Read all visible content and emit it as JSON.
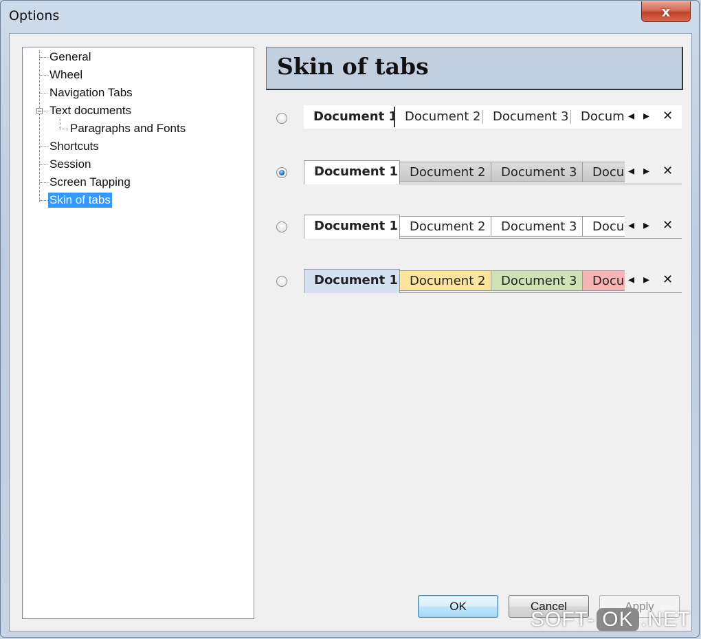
{
  "window": {
    "title": "Options",
    "close_glyph": "x"
  },
  "tree": {
    "items": [
      {
        "label": "General"
      },
      {
        "label": "Wheel"
      },
      {
        "label": "Navigation Tabs"
      },
      {
        "label": "Text documents"
      },
      {
        "label": "Paragraphs and Fonts"
      },
      {
        "label": "Shortcuts"
      },
      {
        "label": "Session"
      },
      {
        "label": "Screen Tapping"
      },
      {
        "label": "Skin of tabs",
        "selected": true
      }
    ]
  },
  "panel": {
    "title": "Skin of tabs"
  },
  "skins": [
    {
      "selected": false,
      "tabs": [
        "Document 1",
        "Document 2",
        "Document 3",
        "Docum"
      ]
    },
    {
      "selected": true,
      "tabs": [
        "Document 1",
        "Document 2",
        "Document 3",
        "Docu"
      ]
    },
    {
      "selected": false,
      "tabs": [
        "Document 1",
        "Document 2",
        "Document 3",
        "Docu"
      ]
    },
    {
      "selected": false,
      "tabs": [
        "Document 1",
        "Document 2",
        "Document 3",
        "Docu"
      ],
      "colors": [
        "#d5e0f1",
        "#fbe49b",
        "#cfe2b6",
        "#f7b4b4"
      ]
    }
  ],
  "tab_controls": {
    "prev": "◂",
    "next": "▸",
    "close": "✕"
  },
  "buttons": {
    "ok": "OK",
    "cancel": "Cancel",
    "apply": "Apply"
  },
  "watermark": {
    "left": "SOFT-",
    "mid": "OK",
    "right": ".NET"
  }
}
